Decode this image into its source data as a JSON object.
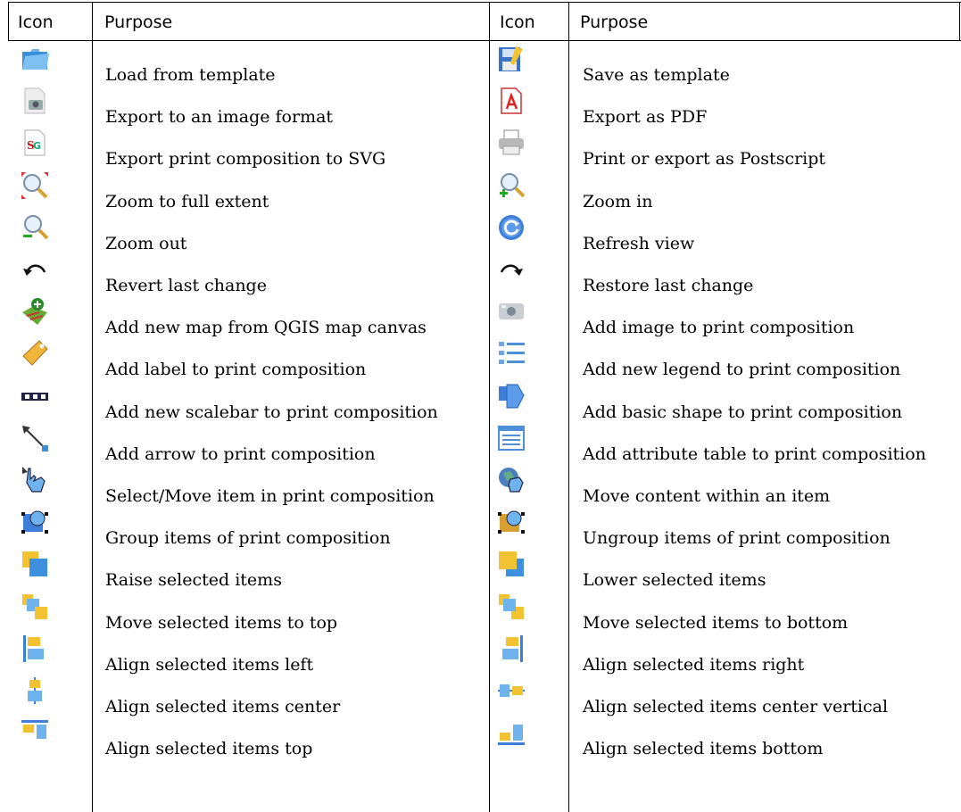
{
  "headers": {
    "icon_left": "Icon",
    "purpose_left": "Purpose",
    "icon_right": "Icon",
    "purpose_right": "Purpose"
  },
  "rows": [
    {
      "left": {
        "icon": "open-folder-icon",
        "text": "Load from template"
      },
      "right": {
        "icon": "save-template-icon",
        "text": "Save as template"
      }
    },
    {
      "left": {
        "icon": "export-image-icon",
        "text": "Export to an image format"
      },
      "right": {
        "icon": "pdf-icon",
        "text": "Export as PDF"
      }
    },
    {
      "left": {
        "icon": "svg-export-icon",
        "text": "Export print composition to SVG"
      },
      "right": {
        "icon": "printer-icon",
        "text": "Print or export as Postscript"
      }
    },
    {
      "left": {
        "icon": "zoom-full-icon",
        "text": "Zoom to full extent"
      },
      "right": {
        "icon": "zoom-in-icon",
        "text": "Zoom in"
      }
    },
    {
      "left": {
        "icon": "zoom-out-icon",
        "text": "Zoom out"
      },
      "right": {
        "icon": "refresh-icon",
        "text": "Refresh view"
      }
    },
    {
      "left": {
        "icon": "undo-icon",
        "text": "Revert last change"
      },
      "right": {
        "icon": "redo-icon",
        "text": "Restore last change"
      }
    },
    {
      "left": {
        "icon": "add-map-icon",
        "text": "Add new map from QGIS map canvas"
      },
      "right": {
        "icon": "add-image-icon",
        "text": "Add image to print composition"
      }
    },
    {
      "left": {
        "icon": "label-tag-icon",
        "text": "Add label to print composition"
      },
      "right": {
        "icon": "legend-icon",
        "text": "Add new legend to print composition"
      }
    },
    {
      "left": {
        "icon": "scalebar-icon",
        "text": "Add new scalebar to print composition"
      },
      "right": {
        "icon": "basic-shape-icon",
        "text": "Add basic shape to print composition"
      }
    },
    {
      "left": {
        "icon": "arrow-icon",
        "text": "Add arrow to print composition"
      },
      "right": {
        "icon": "attribute-table-icon",
        "text": "Add attribute table to print composition"
      }
    },
    {
      "left": {
        "icon": "select-move-icon",
        "text": "Select/Move item in print composition"
      },
      "right": {
        "icon": "move-content-icon",
        "text": "Move content within an item"
      }
    },
    {
      "left": {
        "icon": "group-items-icon",
        "text": "Group items of print composition"
      },
      "right": {
        "icon": "ungroup-items-icon",
        "text": "Ungroup items of print composition"
      }
    },
    {
      "left": {
        "icon": "raise-items-icon",
        "text": "Raise selected items"
      },
      "right": {
        "icon": "lower-items-icon",
        "text": "Lower selected items"
      }
    },
    {
      "left": {
        "icon": "move-top-icon",
        "text": "Move selected items to top"
      },
      "right": {
        "icon": "move-bottom-icon",
        "text": "Move selected items to bottom"
      }
    },
    {
      "left": {
        "icon": "align-left-icon",
        "text": "Align selected items left"
      },
      "right": {
        "icon": "align-right-icon",
        "text": "Align selected items right"
      }
    },
    {
      "left": {
        "icon": "align-center-icon",
        "text": "Align selected items center"
      },
      "right": {
        "icon": "align-center-vertical-icon",
        "text": "Align selected items center vertical"
      }
    },
    {
      "left": {
        "icon": "align-top-icon",
        "text": "Align selected items top"
      },
      "right": {
        "icon": "align-bottom-icon",
        "text": "Align selected items bottom"
      }
    }
  ]
}
